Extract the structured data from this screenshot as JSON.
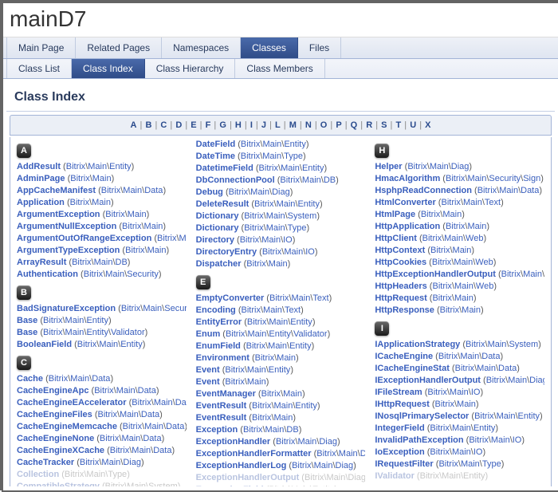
{
  "project": {
    "name": "mainD7"
  },
  "tabs1": [
    {
      "label": "Main Page",
      "current": false
    },
    {
      "label": "Related Pages",
      "current": false
    },
    {
      "label": "Namespaces",
      "current": false
    },
    {
      "label": "Classes",
      "current": true
    },
    {
      "label": "Files",
      "current": false
    }
  ],
  "tabs2": [
    {
      "label": "Class List",
      "current": false
    },
    {
      "label": "Class Index",
      "current": true
    },
    {
      "label": "Class Hierarchy",
      "current": false
    },
    {
      "label": "Class Members",
      "current": false
    }
  ],
  "page_title": "Class Index",
  "alphabet": [
    "A",
    "B",
    "C",
    "D",
    "E",
    "F",
    "G",
    "H",
    "I",
    "J",
    "L",
    "M",
    "N",
    "O",
    "P",
    "Q",
    "R",
    "S",
    "T",
    "U",
    "X"
  ],
  "columns": [
    [
      {
        "type": "letter",
        "letter": "A"
      },
      {
        "type": "entry",
        "cls": "AddResult",
        "ns": "Bitrix\\Main\\Entity"
      },
      {
        "type": "entry",
        "cls": "AdminPage",
        "ns": "Bitrix\\Main"
      },
      {
        "type": "entry",
        "cls": "AppCacheManifest",
        "ns": "Bitrix\\Main\\Data"
      },
      {
        "type": "entry",
        "cls": "Application",
        "ns": "Bitrix\\Main"
      },
      {
        "type": "entry",
        "cls": "ArgumentException",
        "ns": "Bitrix\\Main"
      },
      {
        "type": "entry",
        "cls": "ArgumentNullException",
        "ns": "Bitrix\\Main"
      },
      {
        "type": "entry",
        "cls": "ArgumentOutOfRangeException",
        "ns": "Bitrix\\Main"
      },
      {
        "type": "entry",
        "cls": "ArgumentTypeException",
        "ns": "Bitrix\\Main"
      },
      {
        "type": "entry",
        "cls": "ArrayResult",
        "ns": "Bitrix\\Main\\DB"
      },
      {
        "type": "entry",
        "cls": "Authentication",
        "ns": "Bitrix\\Main\\Security"
      },
      {
        "type": "letter",
        "letter": "B"
      },
      {
        "type": "entry",
        "cls": "BadSignatureException",
        "ns": "Bitrix\\Main\\Security\\Sign"
      },
      {
        "type": "entry",
        "cls": "Base",
        "ns": "Bitrix\\Main\\Entity"
      },
      {
        "type": "entry",
        "cls": "Base",
        "ns": "Bitrix\\Main\\Entity\\Validator"
      },
      {
        "type": "entry",
        "cls": "BooleanField",
        "ns": "Bitrix\\Main\\Entity"
      },
      {
        "type": "letter",
        "letter": "C"
      },
      {
        "type": "entry",
        "cls": "Cache",
        "ns": "Bitrix\\Main\\Data"
      },
      {
        "type": "entry",
        "cls": "CacheEngineApc",
        "ns": "Bitrix\\Main\\Data"
      },
      {
        "type": "entry",
        "cls": "CacheEngineEAccelerator",
        "ns": "Bitrix\\Main\\Data"
      },
      {
        "type": "entry",
        "cls": "CacheEngineFiles",
        "ns": "Bitrix\\Main\\Data"
      },
      {
        "type": "entry",
        "cls": "CacheEngineMemcache",
        "ns": "Bitrix\\Main\\Data"
      },
      {
        "type": "entry",
        "cls": "CacheEngineNone",
        "ns": "Bitrix\\Main\\Data"
      },
      {
        "type": "entry",
        "cls": "CacheEngineXCache",
        "ns": "Bitrix\\Main\\Data"
      },
      {
        "type": "entry",
        "cls": "CacheTracker",
        "ns": "Bitrix\\Main\\Diag"
      },
      {
        "type": "entry",
        "cls": "Collection",
        "ns": "Bitrix\\Main\\Type",
        "fade": true
      },
      {
        "type": "entry",
        "cls": "CompatibleStrategy",
        "ns": "Bitrix\\Main\\System",
        "fade": true
      }
    ],
    [
      {
        "type": "entry",
        "cls": "DateField",
        "ns": "Bitrix\\Main\\Entity"
      },
      {
        "type": "entry",
        "cls": "DateTime",
        "ns": "Bitrix\\Main\\Type"
      },
      {
        "type": "entry",
        "cls": "DatetimeField",
        "ns": "Bitrix\\Main\\Entity"
      },
      {
        "type": "entry",
        "cls": "DbConnectionPool",
        "ns": "Bitrix\\Main\\DB"
      },
      {
        "type": "entry",
        "cls": "Debug",
        "ns": "Bitrix\\Main\\Diag"
      },
      {
        "type": "entry",
        "cls": "DeleteResult",
        "ns": "Bitrix\\Main\\Entity"
      },
      {
        "type": "entry",
        "cls": "Dictionary",
        "ns": "Bitrix\\Main\\System"
      },
      {
        "type": "entry",
        "cls": "Dictionary",
        "ns": "Bitrix\\Main\\Type"
      },
      {
        "type": "entry",
        "cls": "Directory",
        "ns": "Bitrix\\Main\\IO"
      },
      {
        "type": "entry",
        "cls": "DirectoryEntry",
        "ns": "Bitrix\\Main\\IO"
      },
      {
        "type": "entry",
        "cls": "Dispatcher",
        "ns": "Bitrix\\Main"
      },
      {
        "type": "letter",
        "letter": "E"
      },
      {
        "type": "entry",
        "cls": "EmptyConverter",
        "ns": "Bitrix\\Main\\Text"
      },
      {
        "type": "entry",
        "cls": "Encoding",
        "ns": "Bitrix\\Main\\Text"
      },
      {
        "type": "entry",
        "cls": "EntityError",
        "ns": "Bitrix\\Main\\Entity"
      },
      {
        "type": "entry",
        "cls": "Enum",
        "ns": "Bitrix\\Main\\Entity\\Validator"
      },
      {
        "type": "entry",
        "cls": "EnumField",
        "ns": "Bitrix\\Main\\Entity"
      },
      {
        "type": "entry",
        "cls": "Environment",
        "ns": "Bitrix\\Main"
      },
      {
        "type": "entry",
        "cls": "Event",
        "ns": "Bitrix\\Main\\Entity"
      },
      {
        "type": "entry",
        "cls": "Event",
        "ns": "Bitrix\\Main"
      },
      {
        "type": "entry",
        "cls": "EventManager",
        "ns": "Bitrix\\Main"
      },
      {
        "type": "entry",
        "cls": "EventResult",
        "ns": "Bitrix\\Main\\Entity"
      },
      {
        "type": "entry",
        "cls": "EventResult",
        "ns": "Bitrix\\Main"
      },
      {
        "type": "entry",
        "cls": "Exception",
        "ns": "Bitrix\\Main\\DB"
      },
      {
        "type": "entry",
        "cls": "ExceptionHandler",
        "ns": "Bitrix\\Main\\Diag"
      },
      {
        "type": "entry",
        "cls": "ExceptionHandlerFormatter",
        "ns": "Bitrix\\Main\\Diag"
      },
      {
        "type": "entry",
        "cls": "ExceptionHandlerLog",
        "ns": "Bitrix\\Main\\Diag"
      },
      {
        "type": "entry",
        "cls": "ExceptionHandlerOutput",
        "ns": "Bitrix\\Main\\Diag",
        "fade": true
      },
      {
        "type": "entry",
        "cls": "ExpressionField",
        "ns": "Bitrix\\Main\\Entity",
        "fade": true
      }
    ],
    [
      {
        "type": "letter",
        "letter": "H"
      },
      {
        "type": "entry",
        "cls": "Helper",
        "ns": "Bitrix\\Main\\Diag"
      },
      {
        "type": "entry",
        "cls": "HmacAlgorithm",
        "ns": "Bitrix\\Main\\Security\\Sign"
      },
      {
        "type": "entry",
        "cls": "HsphpReadConnection",
        "ns": "Bitrix\\Main\\Data"
      },
      {
        "type": "entry",
        "cls": "HtmlConverter",
        "ns": "Bitrix\\Main\\Text"
      },
      {
        "type": "entry",
        "cls": "HtmlPage",
        "ns": "Bitrix\\Main"
      },
      {
        "type": "entry",
        "cls": "HttpApplication",
        "ns": "Bitrix\\Main"
      },
      {
        "type": "entry",
        "cls": "HttpClient",
        "ns": "Bitrix\\Main\\Web"
      },
      {
        "type": "entry",
        "cls": "HttpContext",
        "ns": "Bitrix\\Main"
      },
      {
        "type": "entry",
        "cls": "HttpCookies",
        "ns": "Bitrix\\Main\\Web"
      },
      {
        "type": "entry",
        "cls": "HttpExceptionHandlerOutput",
        "ns": "Bitrix\\Main\\Diag"
      },
      {
        "type": "entry",
        "cls": "HttpHeaders",
        "ns": "Bitrix\\Main\\Web"
      },
      {
        "type": "entry",
        "cls": "HttpRequest",
        "ns": "Bitrix\\Main"
      },
      {
        "type": "entry",
        "cls": "HttpResponse",
        "ns": "Bitrix\\Main"
      },
      {
        "type": "letter",
        "letter": "I"
      },
      {
        "type": "entry",
        "cls": "IApplicationStrategy",
        "ns": "Bitrix\\Main\\System"
      },
      {
        "type": "entry",
        "cls": "ICacheEngine",
        "ns": "Bitrix\\Main\\Data"
      },
      {
        "type": "entry",
        "cls": "ICacheEngineStat",
        "ns": "Bitrix\\Main\\Data"
      },
      {
        "type": "entry",
        "cls": "IExceptionHandlerOutput",
        "ns": "Bitrix\\Main\\Diag"
      },
      {
        "type": "entry",
        "cls": "IFileStream",
        "ns": "Bitrix\\Main\\IO"
      },
      {
        "type": "entry",
        "cls": "IHttpRequest",
        "ns": "Bitrix\\Main"
      },
      {
        "type": "entry",
        "cls": "INosqlPrimarySelector",
        "ns": "Bitrix\\Main\\Entity"
      },
      {
        "type": "entry",
        "cls": "IntegerField",
        "ns": "Bitrix\\Main\\Entity"
      },
      {
        "type": "entry",
        "cls": "InvalidPathException",
        "ns": "Bitrix\\Main\\IO"
      },
      {
        "type": "entry",
        "cls": "IoException",
        "ns": "Bitrix\\Main\\IO"
      },
      {
        "type": "entry",
        "cls": "IRequestFilter",
        "ns": "Bitrix\\Main\\Type"
      },
      {
        "type": "entry",
        "cls": "IValidator",
        "ns": "Bitrix\\Main\\Entity",
        "fade": true
      }
    ]
  ]
}
